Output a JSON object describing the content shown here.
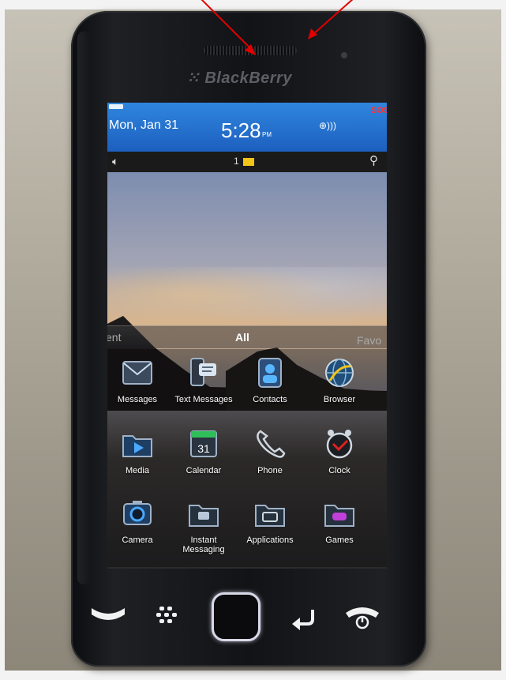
{
  "device": {
    "brand": "BlackBerry"
  },
  "status_bar": {
    "date": "Mon, Jan 31",
    "time": "5:28",
    "ampm": "PM",
    "network_alert": "SOS",
    "signal_glyph": "⊕)))"
  },
  "notify_bar": {
    "message_count": "1"
  },
  "tabs": {
    "left_partial": "ent",
    "center": "All",
    "right_partial": "Favo"
  },
  "apps": [
    {
      "label": "Messages",
      "icon": "envelope-icon"
    },
    {
      "label": "Text Messages",
      "icon": "text-messages-icon"
    },
    {
      "label": "Contacts",
      "icon": "contacts-icon"
    },
    {
      "label": "Browser",
      "icon": "globe-icon"
    },
    {
      "label": "Media",
      "icon": "media-folder-icon"
    },
    {
      "label": "Calendar",
      "icon": "calendar-icon",
      "day": "31"
    },
    {
      "label": "Phone",
      "icon": "phone-handset-icon"
    },
    {
      "label": "Clock",
      "icon": "alarm-clock-icon"
    },
    {
      "label": "Camera",
      "icon": "camera-icon"
    },
    {
      "label": "Instant Messaging",
      "icon": "im-folder-icon"
    },
    {
      "label": "Applications",
      "icon": "applications-folder-icon"
    },
    {
      "label": "Games",
      "icon": "games-folder-icon"
    }
  ],
  "colors": {
    "status_blue": "#1d5fbf",
    "sos_red": "#ff3030",
    "annotation_arrow": "#e00000",
    "envelope_yellow": "#f2c318"
  }
}
